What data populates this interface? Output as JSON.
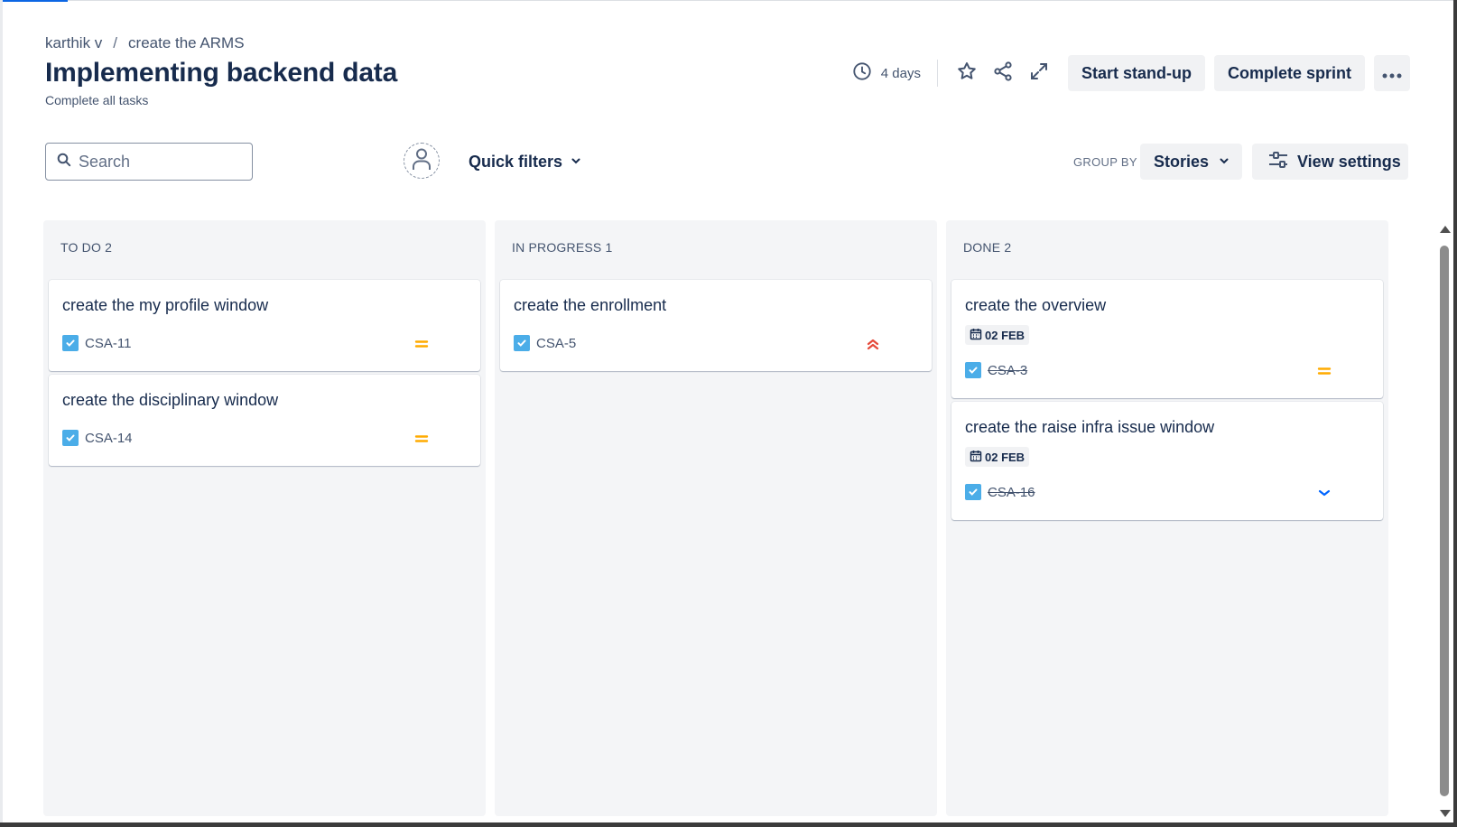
{
  "breadcrumb": {
    "project": "karthik v",
    "separator": "/",
    "board": "create the ARMS"
  },
  "sprint": {
    "title": "Implementing backend data",
    "goal": "Complete all tasks",
    "days_remaining": "4 days"
  },
  "header_actions": {
    "start_standup": "Start stand-up",
    "complete_sprint": "Complete sprint",
    "more": "•••"
  },
  "toolbar": {
    "search_placeholder": "Search",
    "quick_filters": "Quick filters",
    "group_by_label": "GROUP BY",
    "group_by_value": "Stories",
    "view_settings": "View settings"
  },
  "colors": {
    "priority_medium": "#ffab00",
    "priority_highest": "#e5493a",
    "priority_low": "#0065ff",
    "checkbox": "#4bade8"
  },
  "columns": [
    {
      "title": "TO DO 2",
      "cards": [
        {
          "title": "create the my profile window",
          "key": "CSA-11",
          "priority": "medium-priority-icon"
        },
        {
          "title": "create the disciplinary window",
          "key": "CSA-14",
          "priority": "medium-priority-icon"
        }
      ]
    },
    {
      "title": "IN PROGRESS 1",
      "cards": [
        {
          "title": "create the enrollment",
          "key": "CSA-5",
          "priority": "highest-priority-icon"
        }
      ]
    },
    {
      "title": "DONE 2",
      "cards": [
        {
          "title": "create the overview",
          "due": "02 FEB",
          "key": "CSA-3",
          "priority": "medium-priority-icon"
        },
        {
          "title": "create the raise infra issue window",
          "due": "02 FEB",
          "key": "CSA-16",
          "priority": "low-priority-icon"
        }
      ]
    }
  ]
}
